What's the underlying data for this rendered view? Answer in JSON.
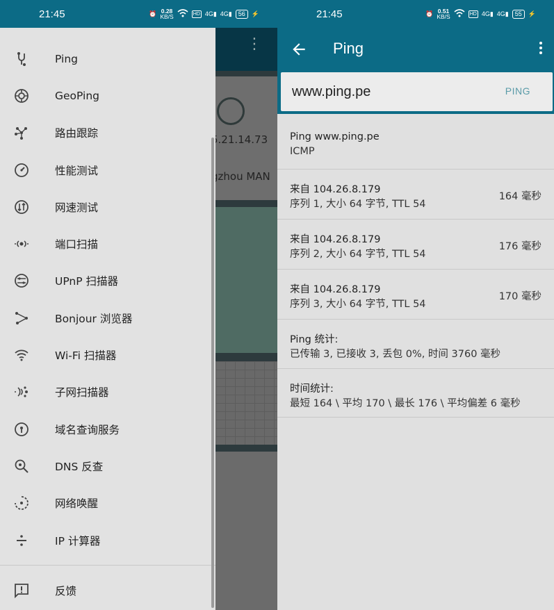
{
  "left_screen": {
    "status": {
      "time": "21:45",
      "speed_value": "0.28",
      "speed_unit": "KB/S",
      "network": "4G",
      "battery": "56"
    },
    "drawer": {
      "items": [
        {
          "label": "Ping",
          "icon": "ping-icon"
        },
        {
          "label": "GeoPing",
          "icon": "geoping-icon"
        },
        {
          "label": "路由跟踪",
          "icon": "traceroute-icon"
        },
        {
          "label": "性能测试",
          "icon": "speedometer-icon"
        },
        {
          "label": "网速测试",
          "icon": "speed-test-icon"
        },
        {
          "label": "端口扫描",
          "icon": "port-scan-icon"
        },
        {
          "label": "UPnP 扫描器",
          "icon": "upnp-icon"
        },
        {
          "label": "Bonjour 浏览器",
          "icon": "bonjour-icon"
        },
        {
          "label": "Wi-Fi 扫描器",
          "icon": "wifi-icon"
        },
        {
          "label": "子网扫描器",
          "icon": "subnet-icon"
        },
        {
          "label": "域名查询服务",
          "icon": "whois-icon"
        },
        {
          "label": "DNS 反查",
          "icon": "dns-lookup-icon"
        },
        {
          "label": "网络唤醒",
          "icon": "wake-on-lan-icon"
        },
        {
          "label": "IP 计算器",
          "icon": "calculator-icon"
        }
      ],
      "feedback_label": "反馈"
    },
    "background_app": {
      "ip_text": "5.21.14.73",
      "location_text": "gzhou MAN"
    }
  },
  "right_screen": {
    "status": {
      "time": "21:45",
      "speed_value": "0.51",
      "speed_unit": "KB/S",
      "network": "4G",
      "battery": "55"
    },
    "toolbar": {
      "title": "Ping"
    },
    "search": {
      "value": "www.ping.pe",
      "button_label": "PING"
    },
    "results": [
      {
        "line1": "Ping www.ping.pe",
        "line2": "ICMP",
        "right": ""
      },
      {
        "line1": "来自 104.26.8.179",
        "line2": "序列 1, 大小 64 字节, TTL 54",
        "right": "164 毫秒"
      },
      {
        "line1": "来自 104.26.8.179",
        "line2": "序列 2, 大小 64 字节, TTL 54",
        "right": "176 毫秒"
      },
      {
        "line1": "来自 104.26.8.179",
        "line2": "序列 3, 大小 64 字节, TTL 54",
        "right": "170 毫秒"
      },
      {
        "line1": "Ping 统计:",
        "line2": "已传输 3, 已接收 3, 丢包 0%, 时间 3760 毫秒",
        "right": ""
      },
      {
        "line1": "时间统计:",
        "line2": "最短 164 \\ 平均 170 \\ 最长 176 \\ 平均偏差 6 毫秒",
        "right": ""
      }
    ]
  },
  "colors": {
    "primary": "#0c6b86",
    "accent": "#5a9ba8",
    "drawer_bg": "#e2e2e2"
  }
}
